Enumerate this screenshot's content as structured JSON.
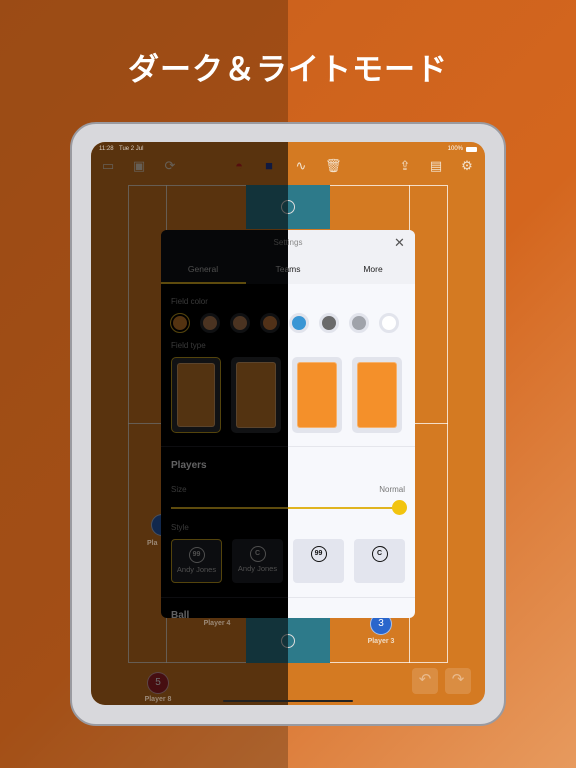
{
  "headline": "ダーク＆ライトモード",
  "status": {
    "time": "11:28",
    "date": "Tue 2 Jul",
    "battery": "100%"
  },
  "toolbar": [
    "folder-icon",
    "play-icon",
    "sync-icon",
    "cap-icon",
    "jersey-icon",
    "dotted-path-icon",
    "trash-icon",
    "share-icon",
    "save-icon",
    "gear-icon"
  ],
  "field": {
    "players": [
      {
        "number": "",
        "label": "Pla",
        "color": "#2a5fb8"
      },
      {
        "number": "",
        "label": "Player 4",
        "color": ""
      },
      {
        "number": "3",
        "label": "Player 3",
        "color": "#2a66cc"
      },
      {
        "number": "5",
        "label": "Player 8",
        "color": "#a8222a"
      }
    ]
  },
  "settings": {
    "title": "Settings",
    "close_icon": "close-icon",
    "tabs": [
      "General",
      "Teams",
      "More"
    ],
    "active_tab": "General",
    "field_color_label": "Field color",
    "field_colors": [
      "#c87a2a",
      "#b27a50",
      "#b27a50",
      "#c0753a",
      "#3a96d4",
      "#6a6a6a",
      "#a0a3aa",
      "#ffffff"
    ],
    "field_type_label": "Field type",
    "players_heading": "Players",
    "size_label": "Size",
    "size_value": "Normal",
    "size_slider": 1.0,
    "style_label": "Style",
    "styles": [
      {
        "badge": "99",
        "name": "Andy Jones"
      },
      {
        "badge": "C",
        "name": "Andy Jones"
      },
      {
        "badge": "99",
        "name": ""
      },
      {
        "badge": "C",
        "name": ""
      }
    ],
    "ball_heading": "Ball"
  },
  "accent": "#e0b420"
}
